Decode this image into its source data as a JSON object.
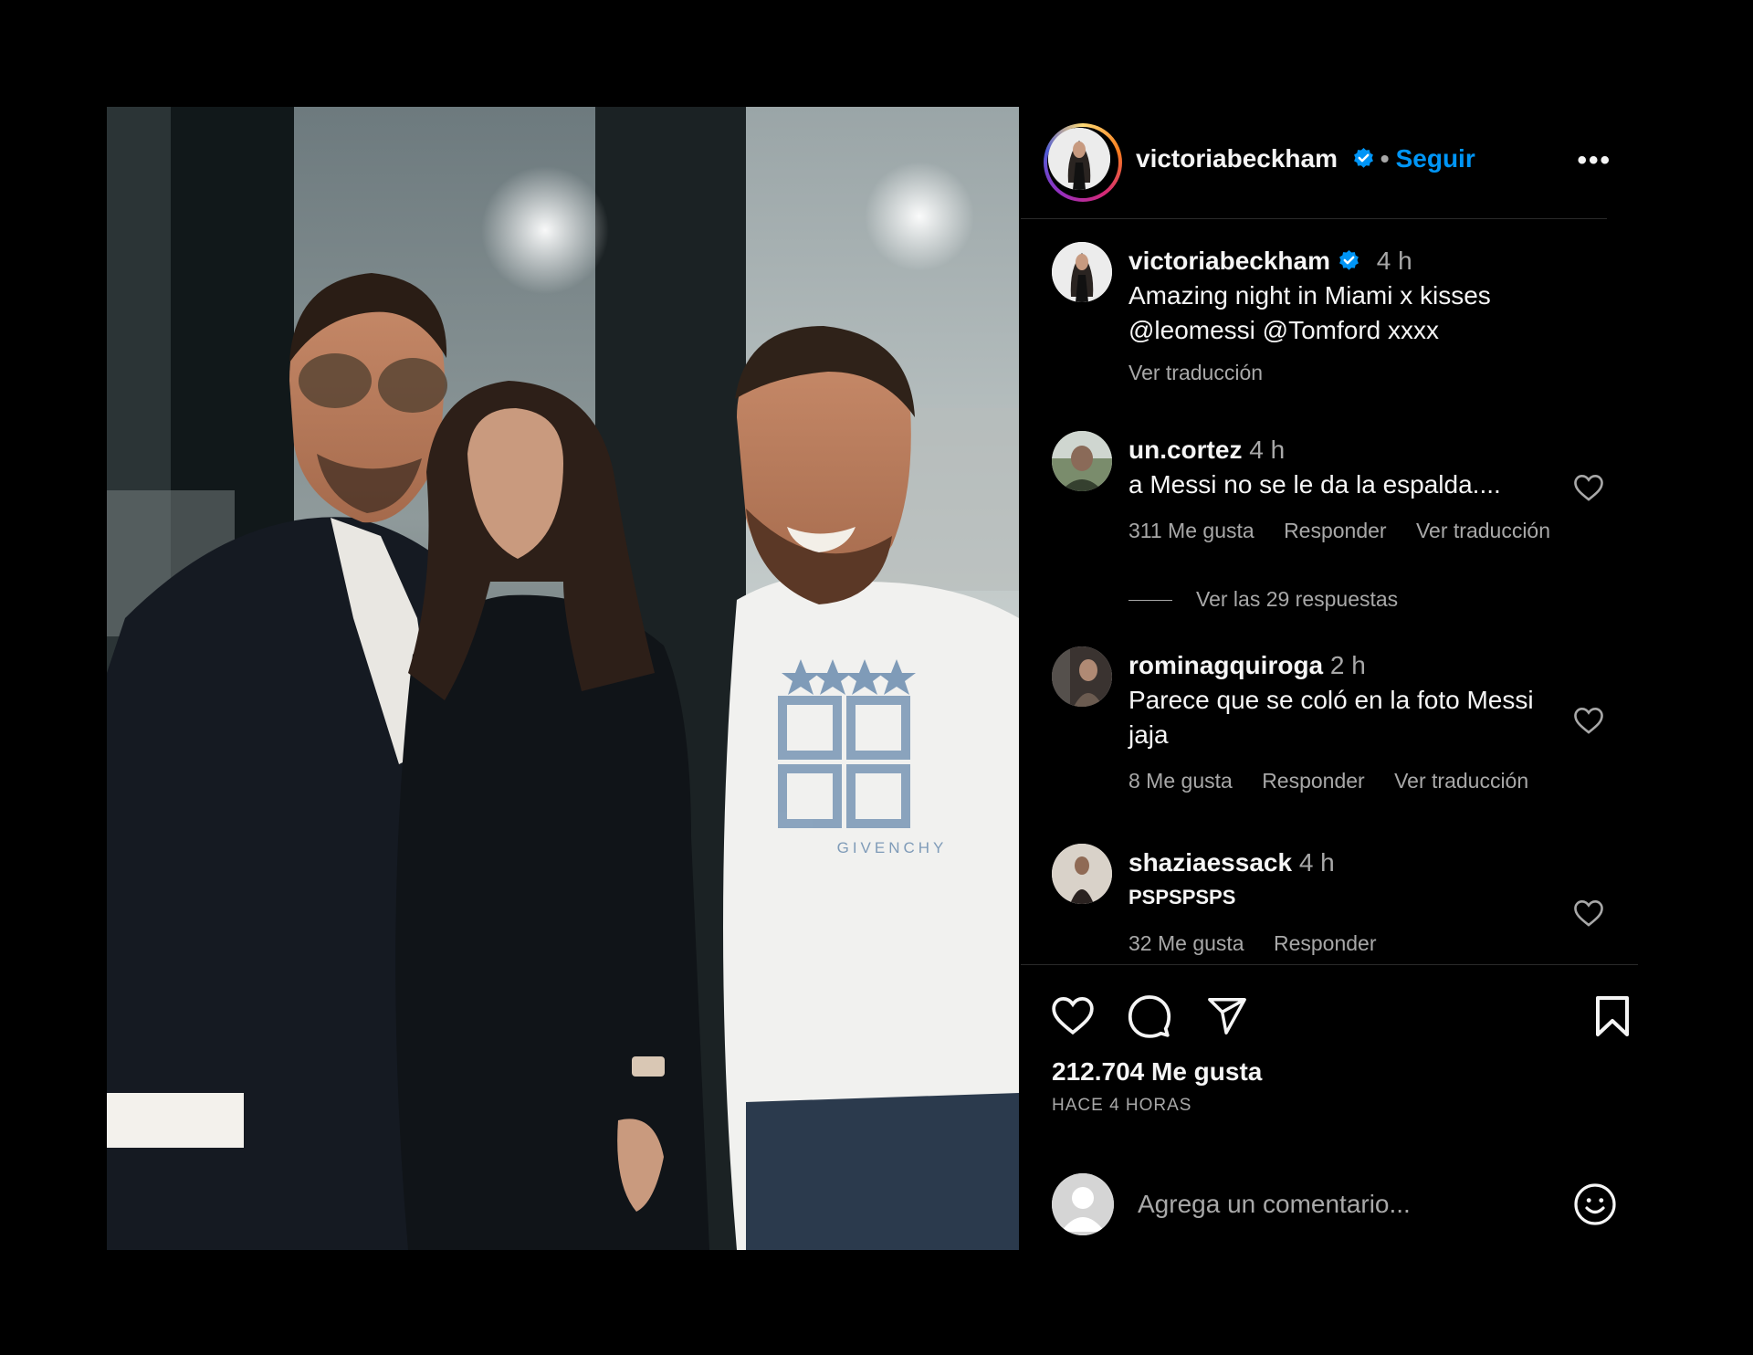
{
  "post": {
    "author": "victoriabeckham",
    "follow_label": "Seguir",
    "more_label": "•••",
    "caption_time": "4 h",
    "caption_line1": "Amazing night in Miami x kisses",
    "caption_line2": "@leomessi @Tomford xxxx",
    "translate_label": "Ver traducción",
    "likes": "212.704 Me gusta",
    "posted_ago": "HACE 4 HORAS",
    "add_comment_placeholder": "Agrega un comentario...",
    "photo_shirt_text": "GIVENCHY"
  },
  "comments": [
    {
      "user": "un.cortez",
      "time": "4 h",
      "text": "a Messi no se le da la espalda....",
      "likes": "311 Me gusta",
      "reply": "Responder",
      "translate": "Ver traducción",
      "view_replies": "Ver las 29 respuestas"
    },
    {
      "user": "rominagquiroga",
      "time": "2 h",
      "text_line1": "Parece que se coló en la foto Messi",
      "text_line2": "jaja",
      "likes": "8 Me gusta",
      "reply": "Responder",
      "translate": "Ver traducción"
    },
    {
      "user": "shaziaessack",
      "time": "4 h",
      "text": "PSPSPSPS",
      "likes": "32 Me gusta",
      "reply": "Responder"
    }
  ],
  "icons": [
    "verified-icon",
    "more-icon",
    "heart-icon",
    "comment-icon",
    "share-icon",
    "bookmark-icon",
    "emoji-icon"
  ],
  "colors": {
    "background": "#000000",
    "text": "#f5f5f5",
    "muted": "#a8a8a8",
    "link": "#0095f6",
    "verified": "#0095f6"
  }
}
